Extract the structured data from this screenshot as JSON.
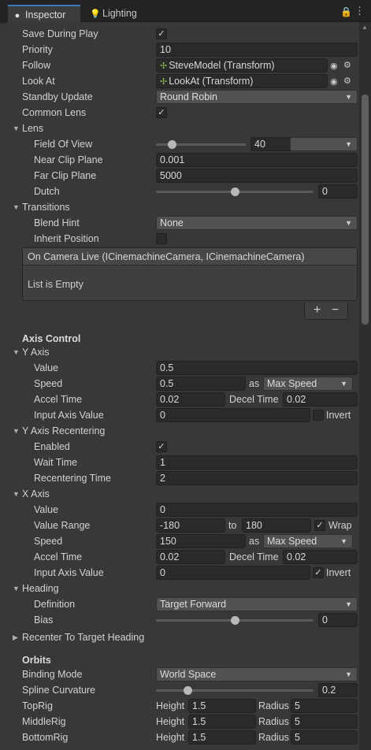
{
  "tabs": {
    "inspector": "Inspector",
    "lighting": "Lighting"
  },
  "rows": {
    "save_during_play": "Save During Play",
    "priority": "Priority",
    "priority_value": "10",
    "follow": "Follow",
    "follow_value": "SteveModel (Transform)",
    "look_at": "Look At",
    "look_at_value": "LookAt (Transform)",
    "standby_update": "Standby Update",
    "standby_update_value": "Round Robin",
    "common_lens": "Common Lens"
  },
  "lens": {
    "header": "Lens",
    "fov_label": "Field Of View",
    "fov_value": "40",
    "near_label": "Near Clip Plane",
    "near_value": "0.001",
    "far_label": "Far Clip Plane",
    "far_value": "5000",
    "dutch_label": "Dutch",
    "dutch_value": "0"
  },
  "transitions": {
    "header": "Transitions",
    "blend_hint_label": "Blend Hint",
    "blend_hint_value": "None",
    "inherit_label": "Inherit Position",
    "event_header": "On Camera Live (ICinemachineCamera, ICinemachineCamera)",
    "empty_text": "List is Empty",
    "add": "+",
    "remove": "−"
  },
  "axis_control": {
    "header": "Axis Control",
    "y_axis": {
      "header": "Y Axis",
      "value_label": "Value",
      "value": "0.5",
      "speed_label": "Speed",
      "speed": "0.5",
      "as": "as",
      "speed_mode": "Max Speed",
      "accel_label": "Accel Time",
      "accel": "0.02",
      "decel_label": "Decel Time",
      "decel": "0.02",
      "input_label": "Input Axis Value",
      "input": "0",
      "invert_label": "Invert"
    },
    "y_recenter": {
      "header": "Y Axis Recentering",
      "enabled_label": "Enabled",
      "wait_label": "Wait Time",
      "wait": "1",
      "recenter_label": "Recentering Time",
      "recenter": "2"
    },
    "x_axis": {
      "header": "X Axis",
      "value_label": "Value",
      "value": "0",
      "range_label": "Value Range",
      "range_min": "-180",
      "to": "to",
      "range_max": "180",
      "wrap_label": "Wrap",
      "speed_label": "Speed",
      "speed": "150",
      "as": "as",
      "speed_mode": "Max Speed",
      "accel_label": "Accel Time",
      "accel": "0.02",
      "decel_label": "Decel Time",
      "decel": "0.02",
      "input_label": "Input Axis Value",
      "input": "0",
      "invert_label": "Invert"
    },
    "heading": {
      "header": "Heading",
      "definition_label": "Definition",
      "definition": "Target Forward",
      "bias_label": "Bias",
      "bias": "0",
      "recenter_heading": "Recenter To Target Heading"
    }
  },
  "orbits": {
    "header": "Orbits",
    "binding_label": "Binding Mode",
    "binding": "World Space",
    "spline_label": "Spline Curvature",
    "spline": "0.2",
    "height": "Height",
    "radius": "Radius",
    "top_label": "TopRig",
    "top_height": "1.5",
    "top_radius": "5",
    "mid_label": "MiddleRig",
    "mid_height": "1.5",
    "mid_radius": "5",
    "bottom_label": "BottomRig",
    "bottom_height": "1.5",
    "bottom_radius": "5"
  },
  "slider_levels": {
    "fov": 0.18,
    "dutch": 0.5,
    "bias": 0.5,
    "spline": 0.2
  },
  "colors": {
    "accent": "#3a79bb",
    "panel": "#383838",
    "field": "#2a2a2a",
    "transform_icon": "#8fbd54"
  }
}
